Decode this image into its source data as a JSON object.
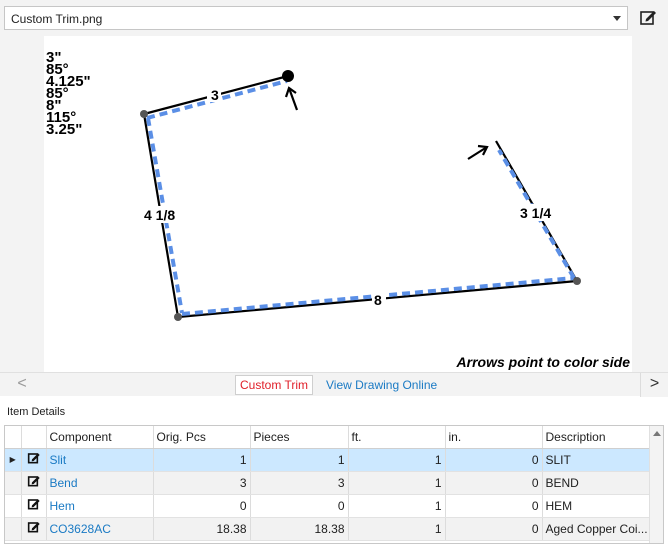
{
  "file_selector": {
    "value": "Custom Trim.png"
  },
  "toolbar": {
    "edit_icon": "edit-icon"
  },
  "drawing": {
    "specs": [
      "3\"",
      "85°",
      "4.125\"",
      "85°",
      "8\"",
      "115°",
      "3.25\""
    ],
    "segment_labels": {
      "top": "3",
      "left": "4 1/8",
      "bottom": "8",
      "right": "3 1/4"
    },
    "note": "Arrows point to color side",
    "colors": {
      "line": "#000000",
      "color_side": "#5b8fe6",
      "vertex": "#555555"
    }
  },
  "nav": {
    "scroll_left": "<",
    "custom_trim": "Custom Trim",
    "view_online": "View Drawing Online",
    "scroll_right": ">",
    "colors": {
      "active": "#e0202a",
      "link": "#1a7ac4"
    }
  },
  "item_details": {
    "title": "Item Details",
    "columns": [
      "Component",
      "Orig. Pcs",
      "Pieces",
      "ft.",
      "in.",
      "Description"
    ],
    "rows": [
      {
        "component": "Slit",
        "orig_pcs": "1",
        "pieces": "1",
        "ft": "1",
        "in": "0",
        "description": "SLIT"
      },
      {
        "component": "Bend",
        "orig_pcs": "3",
        "pieces": "3",
        "ft": "1",
        "in": "0",
        "description": "BEND"
      },
      {
        "component": "Hem",
        "orig_pcs": "0",
        "pieces": "0",
        "ft": "1",
        "in": "0",
        "description": "HEM"
      },
      {
        "component": "CO3628AC",
        "orig_pcs": "18.38",
        "pieces": "18.38",
        "ft": "1",
        "in": "0",
        "description": "Aged Copper Coi..."
      }
    ],
    "selected_row": 0,
    "row_indicator": "▶"
  }
}
